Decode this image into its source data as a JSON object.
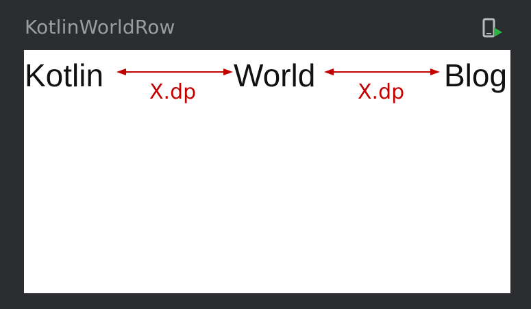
{
  "preview": {
    "title": "KotlinWorldRow",
    "deploy_icon": "deploy-to-device-icon"
  },
  "row": {
    "items": [
      "Kotlin",
      "World",
      "Blog"
    ],
    "spacing_labels": [
      "X.dp",
      "X.dp"
    ]
  },
  "colors": {
    "background": "#2b2d30",
    "title": "#9a9da1",
    "canvas": "#ffffff",
    "text": "#111111",
    "annotation": "#c20000",
    "deploy_green": "#2fb344",
    "deploy_gray": "#b8bbbe"
  }
}
